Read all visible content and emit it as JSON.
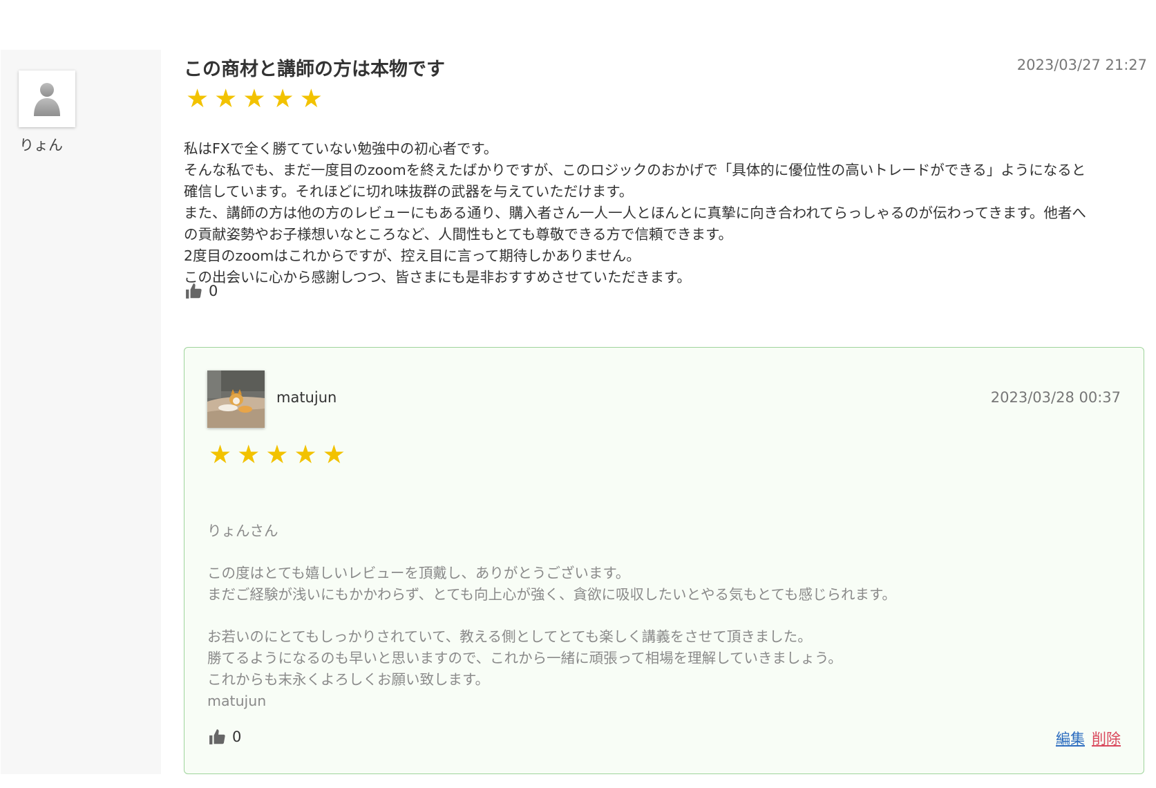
{
  "review": {
    "reviewer_name": "りょん",
    "title": "この商材と講師の方は本物です",
    "date": "2023/03/27 21:27",
    "rating": 5,
    "body_lines": [
      "私はFXで全く勝てていない勉強中の初心者です。",
      "そんな私でも、まだ一度目のzoomを終えたばかりですが、このロジックのおかげで「具体的に優位性の高いトレードができる」ようになると",
      "確信しています。それほどに切れ味抜群の武器を与えていただけます。",
      "また、講師の方は他の方のレビューにもある通り、購入者さん一人一人とほんとに真摯に向き合われてらっしゃるのが伝わってきます。他者へ",
      "の貢献姿勢やお子様想いなところなど、人間性もとても尊敬できる方で信頼できます。",
      "2度目のzoomはこれからですが、控え目に言って期待しかありません。",
      "この出会いに心から感謝しつつ、皆さまにも是非おすすめさせていただきます。"
    ],
    "like_count": "0"
  },
  "reply": {
    "author_name": "matujun",
    "date": "2023/03/28 00:37",
    "rating": 5,
    "body_lines": [
      "りょんさん",
      "",
      "この度はとても嬉しいレビューを頂戴し、ありがとうございます。",
      "まだご経験が浅いにもかかわらず、とても向上心が強く、貪欲に吸収したいとやる気もとても感じられます。",
      "",
      "お若いのにとてもしっかりされていて、教える側としてとても楽しく講義をさせて頂きました。",
      "勝てるようになるのも早いと思いますので、これから一緒に頑張って相場を理解していきましょう。",
      "これからも末永くよろしくお願い致します。",
      "matujun"
    ],
    "like_count": "0",
    "edit_label": "編集",
    "delete_label": "削除"
  },
  "icons": {
    "star": "star-icon",
    "like": "thumbs-up-icon",
    "default_avatar": "user-silhouette-icon",
    "reply_avatar": "cat-photo"
  },
  "colors": {
    "star": "#f2c200",
    "reply_border": "#9fd49b",
    "reply_bg": "#f8fdf6",
    "edit_link": "#2a6bbf",
    "delete_link": "#d9475b"
  }
}
